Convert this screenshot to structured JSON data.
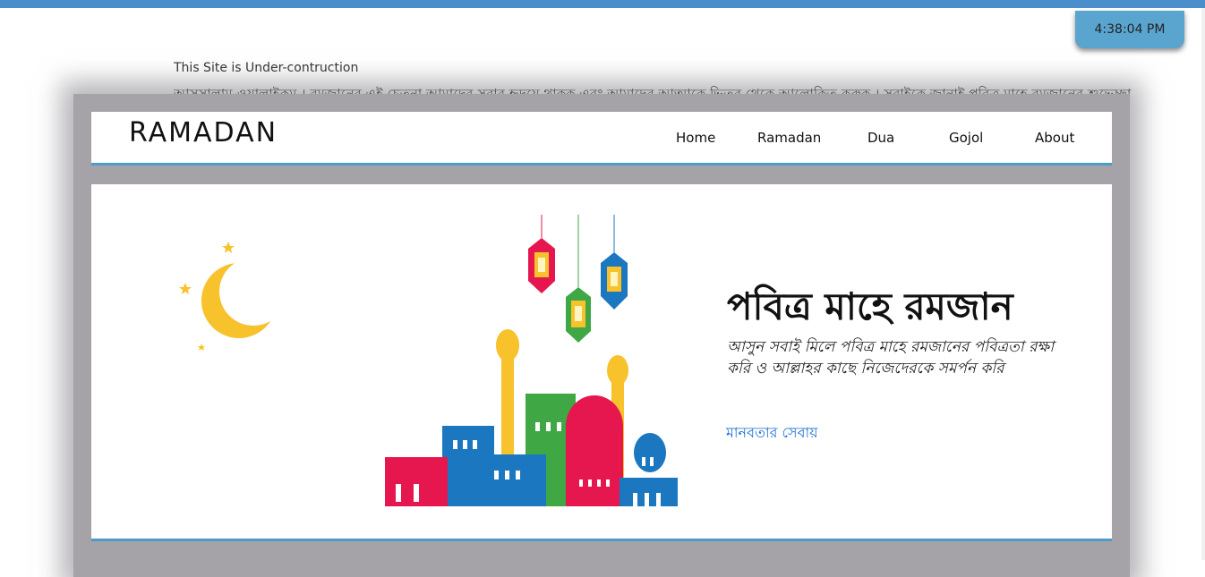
{
  "clock": {
    "time": "4:38:04 PM"
  },
  "notice": {
    "text": "This Site is Under-contruction"
  },
  "marquee": {
    "text": "আসসালামু-ওয়ালাইকুম । রমজানের এই চেতনা আমাদের সবার হৃদয়ে থাকুক এবং আমাদের আত্মাকে ভিতর থেকে আলোকিত করুক । সবাইকে জানাই পবিত্র মাহে রমজানের শুভেচ্ছা"
  },
  "navbar": {
    "logo": "RAMADAN",
    "items": [
      {
        "label": "Home"
      },
      {
        "label": "Ramadan"
      },
      {
        "label": "Dua"
      },
      {
        "label": "Gojol"
      },
      {
        "label": "About"
      }
    ]
  },
  "hero": {
    "title": "পবিত্র মাহে রমজান",
    "subtitle": "আসুন সবাই মিলে পবিত্র মাহে রমজানের পবিত্রতা রক্ষা করি ও আল্লাহর কাছে নিজেদেরকে সমর্পন করি",
    "link": "মানবতার সেবায়"
  },
  "colors": {
    "accent": "#4d9bc8",
    "clock_bg": "#5aa5cf",
    "link": "#1e6fd0",
    "lantern_red": "#e5174e",
    "lantern_green": "#3fa845",
    "lantern_blue": "#1b78c0",
    "moon_yellow": "#f8c22c"
  },
  "icons": [
    "crescent-moon-icon",
    "star-icon",
    "lantern-icon",
    "mosque-illustration"
  ]
}
